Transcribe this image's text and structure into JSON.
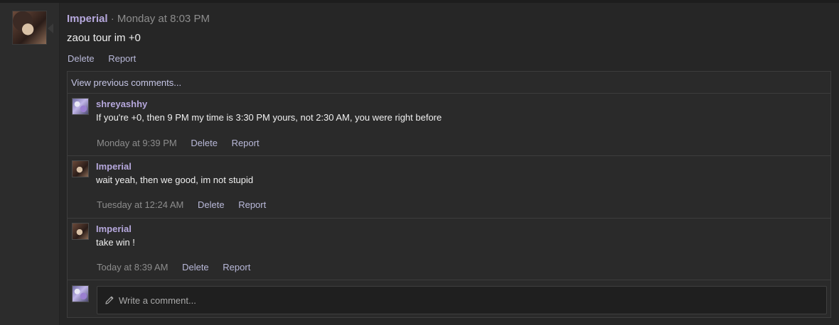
{
  "post": {
    "author": "Imperial",
    "separator": " · ",
    "date": "Monday at 8:03 PM",
    "body": "zaou tour im +0",
    "actions": {
      "delete": "Delete",
      "report": "Report"
    }
  },
  "comments_box": {
    "view_previous": "View previous comments...",
    "comments": [
      {
        "author": "shreyashhy",
        "text": "If you're +0, then 9 PM my time is 3:30 PM yours, not 2:30 AM, you were right before",
        "date": "Monday at 9:39 PM",
        "delete": "Delete",
        "report": "Report",
        "avatar_icon": "user-avatar-icon"
      },
      {
        "author": "Imperial",
        "text": "wait yeah, then we good, im not stupid",
        "date": "Tuesday at 12:24 AM",
        "delete": "Delete",
        "report": "Report",
        "avatar_icon": "user-avatar-icon"
      },
      {
        "author": "Imperial",
        "text": "take win !",
        "date": "Today at 8:39 AM",
        "delete": "Delete",
        "report": "Report",
        "avatar_icon": "user-avatar-icon"
      }
    ],
    "write": {
      "placeholder": "Write a comment...",
      "icon": "pencil-icon"
    }
  },
  "colors": {
    "background": "#262626",
    "author": "#b6a8dd",
    "link": "#b9b9d9",
    "muted": "#8d8d8d",
    "border": "#3d3d3d"
  }
}
